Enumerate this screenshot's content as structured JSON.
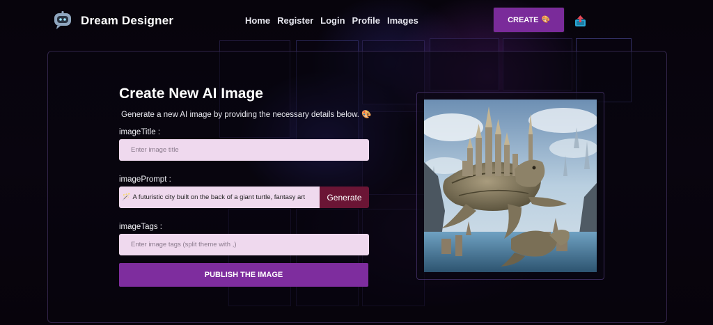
{
  "header": {
    "brand": "Dream Designer",
    "nav": [
      "Home",
      "Register",
      "Login",
      "Profile",
      "Images"
    ],
    "create_label": "CREATE",
    "create_icon": "🎨"
  },
  "form": {
    "title": "Create New AI Image",
    "subtitle": "Generate a new AI image by providing the necessary details below. 🎨",
    "image_title_label": "imageTitle :",
    "image_title_placeholder": "Enter image title",
    "image_prompt_label": "imagePrompt :",
    "image_prompt_value": "A futuristic city built on the back of a giant turtle, fantasy art",
    "wand_icon": "🪄",
    "generate_label": "Generate",
    "image_tags_label": "imageTags :",
    "image_tags_placeholder": "Enter image tags (split theme with ,)",
    "publish_label": "PUBLISH THE IMAGE"
  },
  "colors": {
    "accent": "#7e2d9e",
    "generate": "#6b1535",
    "field_bg": "#efd9ee"
  },
  "icons": {
    "logo": "robot-chat-icon",
    "upload": "upload-icon",
    "preview": "turtle-city-image"
  }
}
